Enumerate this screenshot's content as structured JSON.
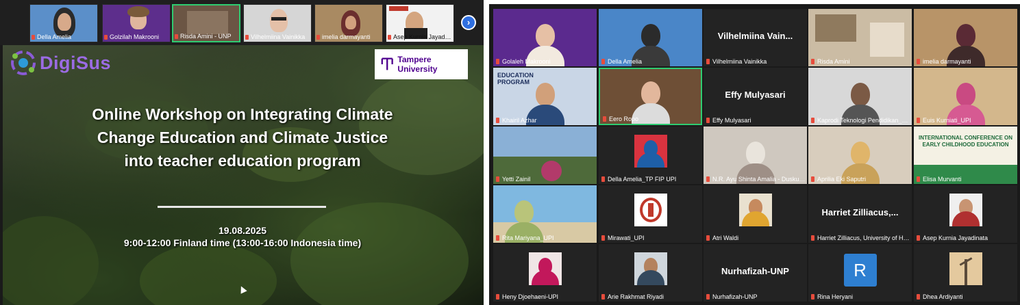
{
  "strip": {
    "thumbs": [
      {
        "name": "Della Amelia"
      },
      {
        "name": "Golzilah Makrooni"
      },
      {
        "name": "Risda Amini - UNP"
      },
      {
        "name": "Vilhelmiina Vainikka"
      },
      {
        "name": "imelia darmayanti"
      },
      {
        "name": "Asep Kurnia Jayadinata"
      }
    ],
    "next_icon": "chevron-right-icon"
  },
  "slide": {
    "logo_left": "DigiSus",
    "logo_right": "Tampere University",
    "title_lines": [
      "Online Workshop on Integrating Climate",
      "Change Education and Climate Justice",
      "into teacher education program"
    ],
    "date": "19.08.2025",
    "time": "9:00-12:00 Finland time (13:00-16:00 Indonesia time)"
  },
  "gallery": {
    "tiles": [
      {
        "name": "Golaleh Makrooni",
        "big": ""
      },
      {
        "name": "Della Amelia",
        "big": ""
      },
      {
        "name": "Vilhelmiina Vainikka",
        "big": "Vilhelmiina Vain..."
      },
      {
        "name": "Risda Amini",
        "big": ""
      },
      {
        "name": "imelia darmayanti",
        "big": ""
      },
      {
        "name": "Khairil Azhar",
        "big": "",
        "overlay": "EDUCATION PROGRAM"
      },
      {
        "name": "Eero Ropo",
        "big": ""
      },
      {
        "name": "Effy Mulyasari",
        "big": "Effy Mulyasari"
      },
      {
        "name": "Kaprodi Teknologi Pendidikan_Dadi ...",
        "big": ""
      },
      {
        "name": "Euis Kurniati_UPI",
        "big": ""
      },
      {
        "name": "Yetti Zainil",
        "big": ""
      },
      {
        "name": "Della Amelia_TP FIP UPI",
        "big": ""
      },
      {
        "name": "N.R. Ayu Shinta Amalia - Duskurjar",
        "big": ""
      },
      {
        "name": "Aprilia Eki Saputri",
        "big": ""
      },
      {
        "name": "Elisa Murvanti",
        "big": "",
        "overlay": "INTERNATIONAL CONFERENCE ON EARLY CHILDHOOD EDUCATION"
      },
      {
        "name": "Rita Mariyana_UPI",
        "big": ""
      },
      {
        "name": "Mirawati_UPI",
        "big": ""
      },
      {
        "name": "Atri Waldi",
        "big": ""
      },
      {
        "name": "Harriet Zilliacus, University of Helsinki",
        "big": "Harriet  Zilliacus,..."
      },
      {
        "name": "Asep Kurnia Jayadinata",
        "big": ""
      },
      {
        "name": "Heny Djoehaeni-UPI",
        "big": ""
      },
      {
        "name": "Arie Rakhmat Riyadi",
        "big": ""
      },
      {
        "name": "Nurhafizah-UNP",
        "big": "Nurhafizah-UNP"
      },
      {
        "name": "Rina Heryani",
        "big": "",
        "letter": "R"
      },
      {
        "name": "Dhea Ardiyanti",
        "big": ""
      }
    ]
  },
  "colors": {
    "speaker_border": "#2ecc71",
    "digisus_purple": "#9b6be3",
    "tampere_purple": "#4e008e",
    "mic_muted_red": "#e74c3c"
  }
}
